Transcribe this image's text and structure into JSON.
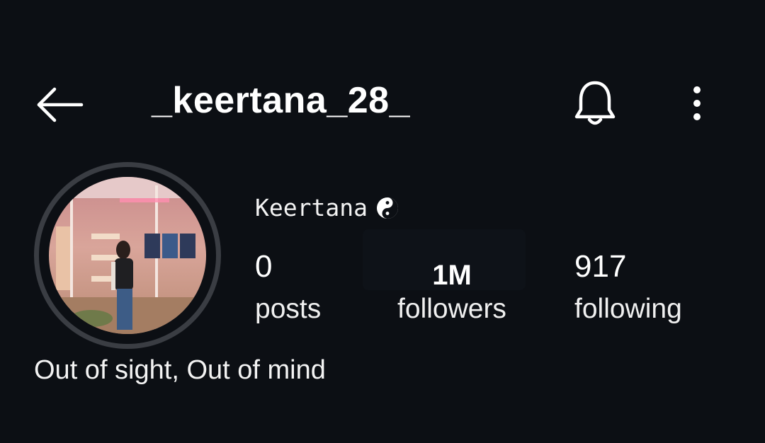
{
  "header": {
    "username": "_keertana_28_",
    "back_icon": "arrow-left-icon",
    "notifications_icon": "bell-icon",
    "more_icon": "more-vertical-icon"
  },
  "profile": {
    "display_name": "Keertana",
    "name_emoji_icon": "yin-yang-icon",
    "avatar_alt": "profile photo",
    "stats": {
      "posts_count": "0",
      "posts_label": "posts",
      "followers_count": "1M",
      "followers_label": "followers",
      "following_count": "917",
      "following_label": "following"
    },
    "bio": "Out of sight, Out of mind"
  },
  "colors": {
    "background": "#0c0f14",
    "text": "#f3f3f3",
    "avatar_ring": "#3a3d43"
  }
}
